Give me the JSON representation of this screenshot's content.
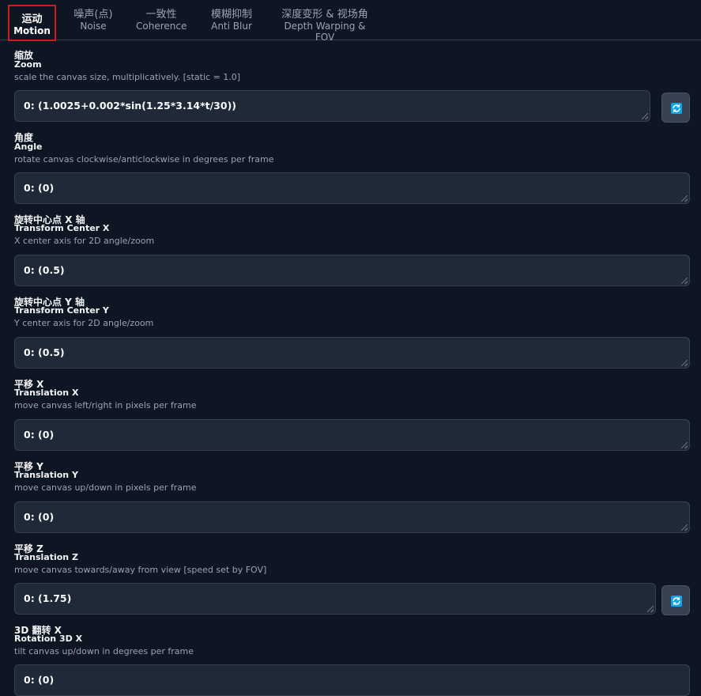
{
  "tabs": [
    {
      "zh": "运动",
      "en": "Motion"
    },
    {
      "zh": "噪声(点)",
      "en": "Noise"
    },
    {
      "zh": "一致性",
      "en": "Coherence"
    },
    {
      "zh": "模糊抑制",
      "en": "Anti Blur"
    },
    {
      "zh": "深度变形 & 视场角",
      "en": "Depth Warping & FOV"
    }
  ],
  "fields": [
    {
      "zh": "缩放",
      "en": "Zoom",
      "desc": "scale the canvas size, multiplicatively. [static = 1.0]",
      "value": "0: (1.0025+0.002*sin(1.25*3.14*t/30))"
    },
    {
      "zh": "角度",
      "en": "Angle",
      "desc": "rotate canvas clockwise/anticlockwise in degrees per frame",
      "value": "0: (0)"
    },
    {
      "zh": "旋转中心点 X 轴",
      "en": "Transform Center X",
      "desc": "X center axis for 2D angle/zoom",
      "value": "0: (0.5)"
    },
    {
      "zh": "旋转中心点 Y 轴",
      "en": "Transform Center Y",
      "desc": "Y center axis for 2D angle/zoom",
      "value": "0: (0.5)"
    },
    {
      "zh": "平移 X",
      "en": "Translation X",
      "desc": "move canvas left/right in pixels per frame",
      "value": "0: (0)"
    },
    {
      "zh": "平移 Y",
      "en": "Translation Y",
      "desc": "move canvas up/down in pixels per frame",
      "value": "0: (0)"
    },
    {
      "zh": "平移 Z",
      "en": "Translation Z",
      "desc": "move canvas towards/away from view [speed set by FOV]",
      "value": "0: (1.75)"
    },
    {
      "zh": "3D 翻转 X",
      "en": "Rotation 3D X",
      "desc": "tilt canvas up/down in degrees per frame",
      "value": "0: (0)"
    }
  ],
  "colors": {
    "accent": "#0ea5e9",
    "active_tab_border": "#d11c1c",
    "background": "#0f1623"
  },
  "icons": {
    "refresh": "refresh-icon"
  }
}
